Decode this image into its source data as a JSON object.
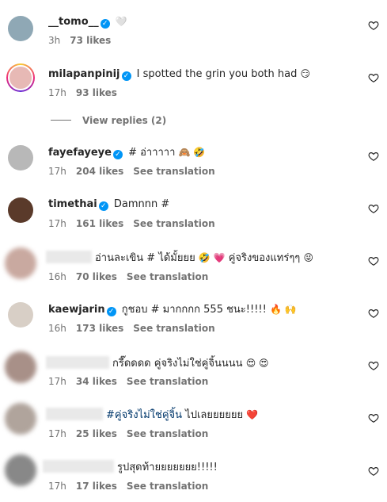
{
  "comments": [
    {
      "user": "__tomo__",
      "text": "",
      "emoji": "🤍",
      "time": "3h",
      "likes": "73 likes",
      "translate": "",
      "avatar_color": "#8fa8b5"
    },
    {
      "user": "milapanpinij",
      "text": "I spotted the grin you both had",
      "emoji": "😏",
      "time": "17h",
      "likes": "93 likes",
      "translate": "",
      "avatar_color": "#e7b9b5"
    },
    {
      "user": "fayefayeye",
      "text": "# อ่าาาาา",
      "emoji": "🙈 🤣",
      "time": "17h",
      "likes": "204 likes",
      "translate": "See translation",
      "avatar_color": "#b8b8b8"
    },
    {
      "user": "timethai",
      "text": "Damnnn #",
      "emoji": "",
      "time": "17h",
      "likes": "161 likes",
      "translate": "See translation",
      "avatar_color": "#5a3a2a"
    },
    {
      "user": "",
      "text": "อ่านละเขิน # ได้มั้ยยย",
      "emoji": "🤣 💗",
      "text2": "คู่จริงของแทร่ๆๆ",
      "emoji2": "😜",
      "time": "16h",
      "likes": "70 likes",
      "translate": "See translation",
      "avatar_color": "#c9a9a0"
    },
    {
      "user": "kaewjarin",
      "text": "กูชอบ # มากกกก 555 ชนะ!!!!!",
      "emoji": "🔥 🙌",
      "time": "16h",
      "likes": "173 likes",
      "translate": "See translation",
      "avatar_color": "#d8cfc6"
    },
    {
      "user": "",
      "text": "กรี๊ดดดด คู่จริงไม่ใช่คู่จิ้นนนน",
      "emoji": "😍 😍",
      "time": "17h",
      "likes": "34 likes",
      "translate": "See translation",
      "avatar_color": "#a89088"
    },
    {
      "user": "",
      "text": "#คู่จริงไม่ใช่คู่จิ้น",
      "text_rest": "ไปเลยยยยยย",
      "emoji": "❤️",
      "time": "17h",
      "likes": "25 likes",
      "translate": "See translation",
      "avatar_color": "#b0a49c"
    },
    {
      "user": "",
      "text": "รูปสุดท้ายยยยยยย!!!!!",
      "emoji": "",
      "time": "17h",
      "likes": "17 likes",
      "translate": "See translation",
      "avatar_color": "#888888"
    }
  ],
  "view_replies": "View replies (2)",
  "verified_mark": "✓"
}
